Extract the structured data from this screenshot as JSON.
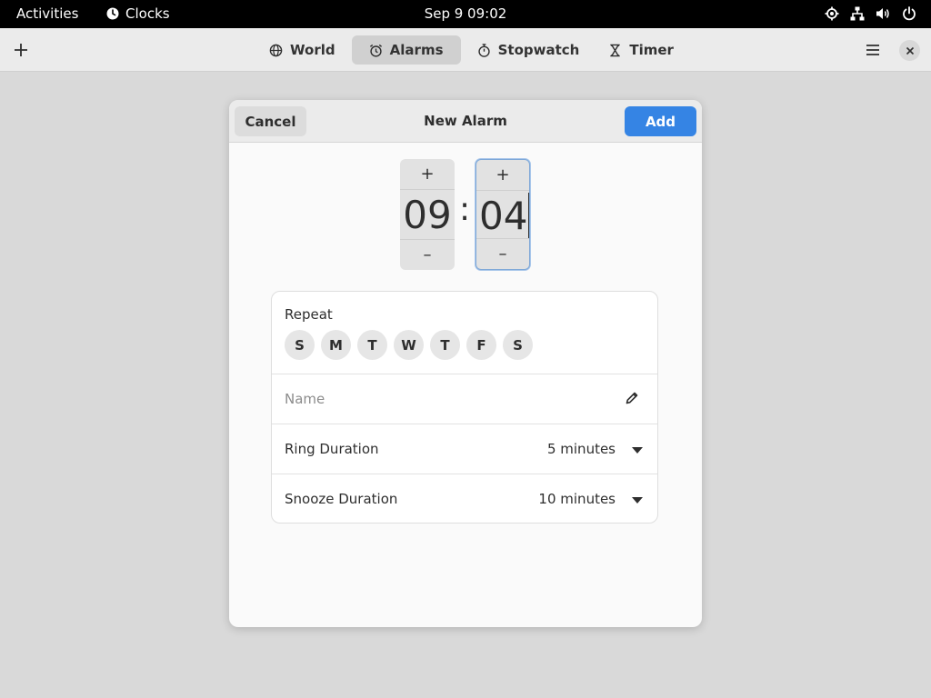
{
  "topbar": {
    "activities": "Activities",
    "app_name": "Clocks",
    "datetime": "Sep 9  09:02"
  },
  "headerbar": {
    "tabs": [
      {
        "label": "World",
        "icon": "globe-icon"
      },
      {
        "label": "Alarms",
        "icon": "alarm-clock-icon",
        "active": true
      },
      {
        "label": "Stopwatch",
        "icon": "stopwatch-icon"
      },
      {
        "label": "Timer",
        "icon": "hourglass-icon"
      }
    ]
  },
  "dialog": {
    "title": "New Alarm",
    "cancel_label": "Cancel",
    "add_label": "Add",
    "hours": "09",
    "minutes": "04",
    "separator": ":",
    "spin_plus": "+",
    "spin_minus": "–",
    "repeat_label": "Repeat",
    "days": [
      "S",
      "M",
      "T",
      "W",
      "T",
      "F",
      "S"
    ],
    "name_placeholder": "Name",
    "ring_duration_label": "Ring Duration",
    "ring_duration_value": "5 minutes",
    "snooze_duration_label": "Snooze Duration",
    "snooze_duration_value": "10 minutes"
  },
  "colors": {
    "accent": "#3584e4",
    "topbar_bg": "#000000",
    "headerbar_bg": "#ebebeb"
  }
}
